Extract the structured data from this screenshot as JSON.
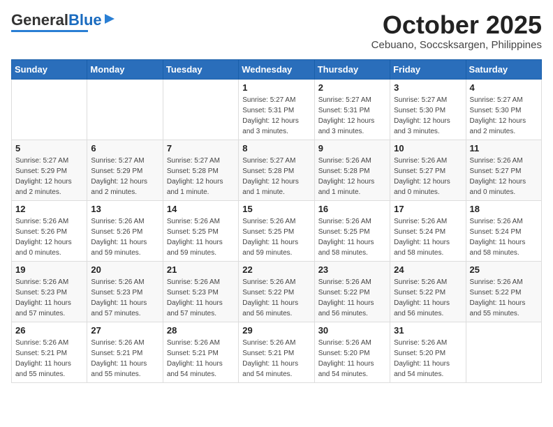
{
  "header": {
    "logo_general": "General",
    "logo_blue": "Blue",
    "month": "October 2025",
    "location": "Cebuano, Soccsksargen, Philippines"
  },
  "days_of_week": [
    "Sunday",
    "Monday",
    "Tuesday",
    "Wednesday",
    "Thursday",
    "Friday",
    "Saturday"
  ],
  "weeks": [
    [
      {
        "day": "",
        "info": ""
      },
      {
        "day": "",
        "info": ""
      },
      {
        "day": "",
        "info": ""
      },
      {
        "day": "1",
        "info": "Sunrise: 5:27 AM\nSunset: 5:31 PM\nDaylight: 12 hours\nand 3 minutes."
      },
      {
        "day": "2",
        "info": "Sunrise: 5:27 AM\nSunset: 5:31 PM\nDaylight: 12 hours\nand 3 minutes."
      },
      {
        "day": "3",
        "info": "Sunrise: 5:27 AM\nSunset: 5:30 PM\nDaylight: 12 hours\nand 3 minutes."
      },
      {
        "day": "4",
        "info": "Sunrise: 5:27 AM\nSunset: 5:30 PM\nDaylight: 12 hours\nand 2 minutes."
      }
    ],
    [
      {
        "day": "5",
        "info": "Sunrise: 5:27 AM\nSunset: 5:29 PM\nDaylight: 12 hours\nand 2 minutes."
      },
      {
        "day": "6",
        "info": "Sunrise: 5:27 AM\nSunset: 5:29 PM\nDaylight: 12 hours\nand 2 minutes."
      },
      {
        "day": "7",
        "info": "Sunrise: 5:27 AM\nSunset: 5:28 PM\nDaylight: 12 hours\nand 1 minute."
      },
      {
        "day": "8",
        "info": "Sunrise: 5:27 AM\nSunset: 5:28 PM\nDaylight: 12 hours\nand 1 minute."
      },
      {
        "day": "9",
        "info": "Sunrise: 5:26 AM\nSunset: 5:28 PM\nDaylight: 12 hours\nand 1 minute."
      },
      {
        "day": "10",
        "info": "Sunrise: 5:26 AM\nSunset: 5:27 PM\nDaylight: 12 hours\nand 0 minutes."
      },
      {
        "day": "11",
        "info": "Sunrise: 5:26 AM\nSunset: 5:27 PM\nDaylight: 12 hours\nand 0 minutes."
      }
    ],
    [
      {
        "day": "12",
        "info": "Sunrise: 5:26 AM\nSunset: 5:26 PM\nDaylight: 12 hours\nand 0 minutes."
      },
      {
        "day": "13",
        "info": "Sunrise: 5:26 AM\nSunset: 5:26 PM\nDaylight: 11 hours\nand 59 minutes."
      },
      {
        "day": "14",
        "info": "Sunrise: 5:26 AM\nSunset: 5:25 PM\nDaylight: 11 hours\nand 59 minutes."
      },
      {
        "day": "15",
        "info": "Sunrise: 5:26 AM\nSunset: 5:25 PM\nDaylight: 11 hours\nand 59 minutes."
      },
      {
        "day": "16",
        "info": "Sunrise: 5:26 AM\nSunset: 5:25 PM\nDaylight: 11 hours\nand 58 minutes."
      },
      {
        "day": "17",
        "info": "Sunrise: 5:26 AM\nSunset: 5:24 PM\nDaylight: 11 hours\nand 58 minutes."
      },
      {
        "day": "18",
        "info": "Sunrise: 5:26 AM\nSunset: 5:24 PM\nDaylight: 11 hours\nand 58 minutes."
      }
    ],
    [
      {
        "day": "19",
        "info": "Sunrise: 5:26 AM\nSunset: 5:23 PM\nDaylight: 11 hours\nand 57 minutes."
      },
      {
        "day": "20",
        "info": "Sunrise: 5:26 AM\nSunset: 5:23 PM\nDaylight: 11 hours\nand 57 minutes."
      },
      {
        "day": "21",
        "info": "Sunrise: 5:26 AM\nSunset: 5:23 PM\nDaylight: 11 hours\nand 57 minutes."
      },
      {
        "day": "22",
        "info": "Sunrise: 5:26 AM\nSunset: 5:22 PM\nDaylight: 11 hours\nand 56 minutes."
      },
      {
        "day": "23",
        "info": "Sunrise: 5:26 AM\nSunset: 5:22 PM\nDaylight: 11 hours\nand 56 minutes."
      },
      {
        "day": "24",
        "info": "Sunrise: 5:26 AM\nSunset: 5:22 PM\nDaylight: 11 hours\nand 56 minutes."
      },
      {
        "day": "25",
        "info": "Sunrise: 5:26 AM\nSunset: 5:22 PM\nDaylight: 11 hours\nand 55 minutes."
      }
    ],
    [
      {
        "day": "26",
        "info": "Sunrise: 5:26 AM\nSunset: 5:21 PM\nDaylight: 11 hours\nand 55 minutes."
      },
      {
        "day": "27",
        "info": "Sunrise: 5:26 AM\nSunset: 5:21 PM\nDaylight: 11 hours\nand 55 minutes."
      },
      {
        "day": "28",
        "info": "Sunrise: 5:26 AM\nSunset: 5:21 PM\nDaylight: 11 hours\nand 54 minutes."
      },
      {
        "day": "29",
        "info": "Sunrise: 5:26 AM\nSunset: 5:21 PM\nDaylight: 11 hours\nand 54 minutes."
      },
      {
        "day": "30",
        "info": "Sunrise: 5:26 AM\nSunset: 5:20 PM\nDaylight: 11 hours\nand 54 minutes."
      },
      {
        "day": "31",
        "info": "Sunrise: 5:26 AM\nSunset: 5:20 PM\nDaylight: 11 hours\nand 54 minutes."
      },
      {
        "day": "",
        "info": ""
      }
    ]
  ]
}
